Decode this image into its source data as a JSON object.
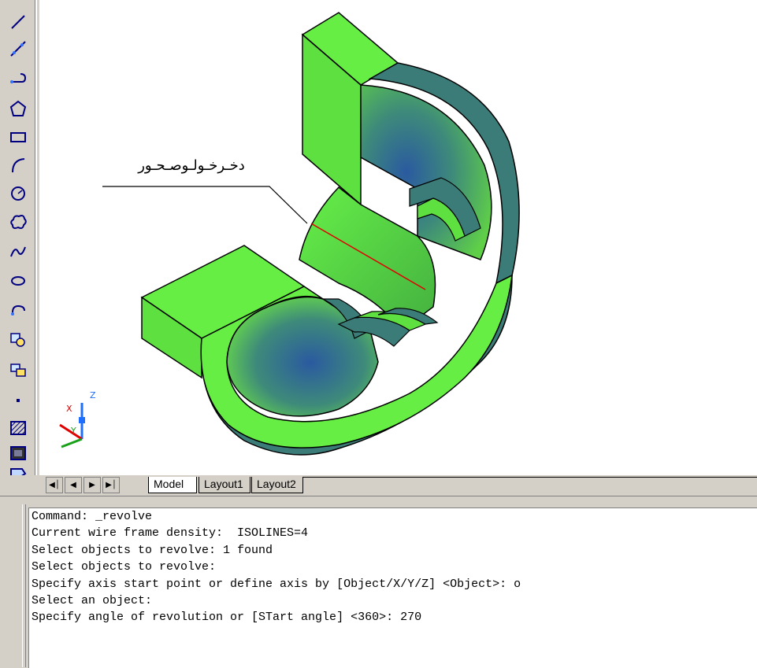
{
  "toolbar": {
    "tools": [
      "line-icon",
      "construction-line-icon",
      "polyline-icon",
      "polygon-icon",
      "rectangle-icon",
      "arc-icon",
      "circle-icon",
      "revision-cloud-icon",
      "spline-icon",
      "ellipse-icon",
      "ellipse-arc-icon",
      "insert-block-icon",
      "make-block-icon",
      "point-icon",
      "hatch-icon",
      "gradient-icon",
      "region-icon"
    ]
  },
  "drawing": {
    "annotation_label": "دخـرخـولـوصـحـور",
    "ucs": {
      "x": "X",
      "y": "Y",
      "z": "Z"
    },
    "colors": {
      "solid_face": "#66ee44",
      "shade": "#3a7a76",
      "axis": "#e00000"
    }
  },
  "layout_tabs": {
    "nav": [
      "first-tab",
      "previous-tab",
      "next-tab",
      "last-tab"
    ],
    "tabs": [
      "Model",
      "Layout1",
      "Layout2"
    ],
    "active": "Model"
  },
  "command": {
    "lines": [
      "Command: _revolve",
      "Current wire frame density:  ISOLINES=4",
      "Select objects to revolve: 1 found",
      "Select objects to revolve:",
      "Specify axis start point or define axis by [Object/X/Y/Z] <Object>: o",
      "Select an object:",
      "Specify angle of revolution or [STart angle] <360>: 270"
    ]
  }
}
